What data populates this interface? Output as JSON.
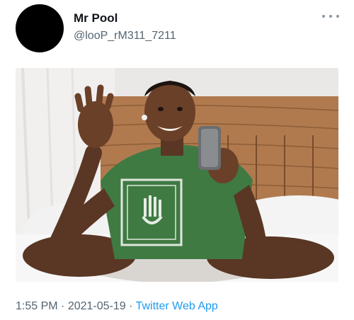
{
  "author": {
    "name": "Mr Pool",
    "handle": "@looP_rM311_7211"
  },
  "footer": {
    "time": "1:55 PM",
    "separator": "·",
    "date": "2021-05-19",
    "source": "Twitter Web App"
  },
  "icons": {
    "avatar": "avatar-placeholder",
    "more": "more-icon"
  },
  "colors": {
    "link": "#1d9bf0",
    "secondary_text": "#536471",
    "shirt": "#3f7a43"
  }
}
